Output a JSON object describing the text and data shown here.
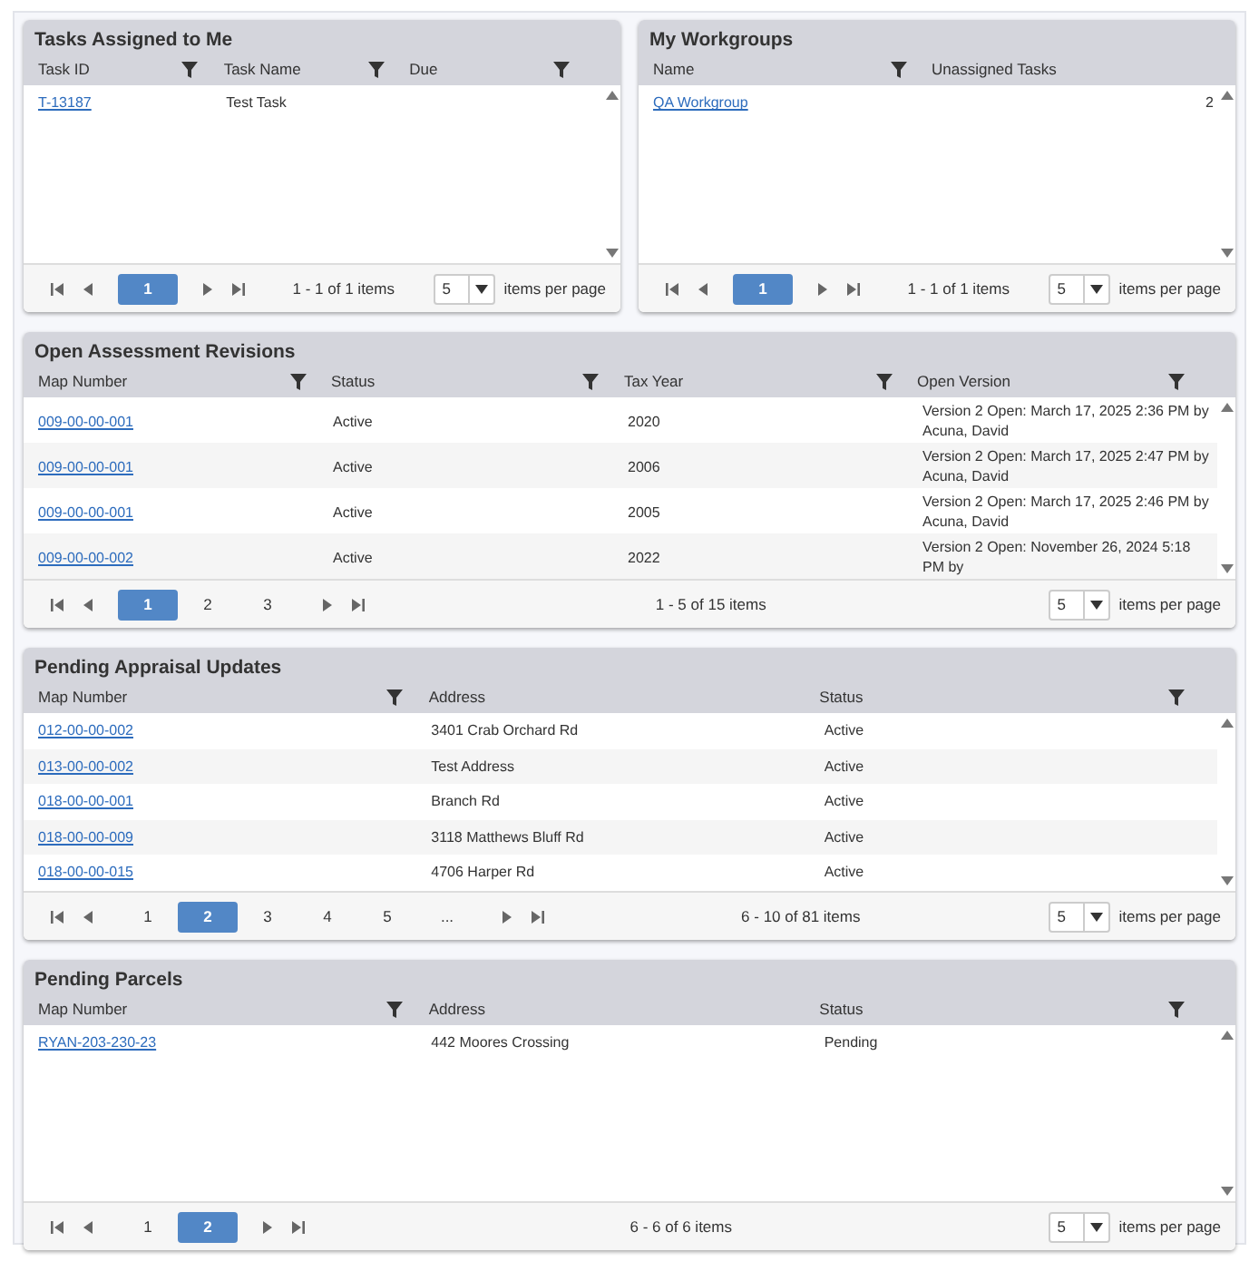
{
  "panels": [
    {
      "title": "Tasks Assigned to Me",
      "columns": [
        {
          "label": "Task ID",
          "kind": "link",
          "filterable": true
        },
        {
          "label": "Task Name",
          "kind": "text",
          "filterable": true
        },
        {
          "label": "Due",
          "kind": "text",
          "filterable": true
        }
      ],
      "rows": [
        [
          "T-13187",
          "Test Task",
          ""
        ]
      ],
      "pager": {
        "pages": [
          {
            "label": "1",
            "selected": true
          }
        ],
        "info": "1 - 1 of 1 items",
        "page_size": "5",
        "page_size_label": "items per page"
      }
    },
    {
      "title": "My Workgroups",
      "columns": [
        {
          "label": "Name",
          "kind": "link",
          "filterable": true
        },
        {
          "label": "Unassigned Tasks",
          "kind": "number",
          "filterable": false
        }
      ],
      "rows": [
        [
          "QA Workgroup",
          "2"
        ]
      ],
      "pager": {
        "pages": [
          {
            "label": "1",
            "selected": true
          }
        ],
        "info": "1 - 1 of 1 items",
        "page_size": "5",
        "page_size_label": "items per page"
      }
    },
    {
      "title": "Open Assessment Revisions",
      "columns": [
        {
          "label": "Map Number",
          "kind": "link",
          "filterable": true
        },
        {
          "label": "Status",
          "kind": "text",
          "filterable": true
        },
        {
          "label": "Tax Year",
          "kind": "text",
          "filterable": true
        },
        {
          "label": "Open Version",
          "kind": "text",
          "filterable": true
        }
      ],
      "rows": [
        [
          "009-00-00-001",
          "Active",
          "2020",
          "Version 2 Open: March 17, 2025 2:36 PM by Acuna, David"
        ],
        [
          "009-00-00-001",
          "Active",
          "2006",
          "Version 2 Open: March 17, 2025 2:47 PM by Acuna, David"
        ],
        [
          "009-00-00-001",
          "Active",
          "2005",
          "Version 2 Open: March 17, 2025 2:46 PM by Acuna, David"
        ],
        [
          "009-00-00-002",
          "Active",
          "2022",
          "Version 2 Open: November 26, 2024 5:18 PM by"
        ]
      ],
      "pager": {
        "pages": [
          {
            "label": "1",
            "selected": true
          },
          {
            "label": "2",
            "selected": false
          },
          {
            "label": "3",
            "selected": false
          }
        ],
        "info": "1 - 5 of 15 items",
        "page_size": "5",
        "page_size_label": "items per page"
      }
    },
    {
      "title": "Pending Appraisal Updates",
      "columns": [
        {
          "label": "Map Number",
          "kind": "link",
          "filterable": true
        },
        {
          "label": "Address",
          "kind": "text",
          "filterable": false
        },
        {
          "label": "Status",
          "kind": "text",
          "filterable": true
        }
      ],
      "rows": [
        [
          "012-00-00-002",
          "3401 Crab Orchard Rd",
          "Active"
        ],
        [
          "013-00-00-002",
          "Test Address",
          "Active"
        ],
        [
          "018-00-00-001",
          "Branch Rd",
          "Active"
        ],
        [
          "018-00-00-009",
          "3118 Matthews Bluff Rd",
          "Active"
        ],
        [
          "018-00-00-015",
          "4706 Harper Rd",
          "Active"
        ]
      ],
      "pager": {
        "pages": [
          {
            "label": "1",
            "selected": false
          },
          {
            "label": "2",
            "selected": true
          },
          {
            "label": "3",
            "selected": false
          },
          {
            "label": "4",
            "selected": false
          },
          {
            "label": "5",
            "selected": false
          },
          {
            "label": "...",
            "selected": false
          }
        ],
        "info": "6 - 10 of 81 items",
        "page_size": "5",
        "page_size_label": "items per page"
      }
    },
    {
      "title": "Pending Parcels",
      "columns": [
        {
          "label": "Map Number",
          "kind": "link",
          "filterable": true
        },
        {
          "label": "Address",
          "kind": "text",
          "filterable": false
        },
        {
          "label": "Status",
          "kind": "text",
          "filterable": true
        }
      ],
      "rows": [
        [
          "RYAN-203-230-23",
          "442 Moores Crossing",
          "Pending"
        ]
      ],
      "pager": {
        "pages": [
          {
            "label": "1",
            "selected": false
          },
          {
            "label": "2",
            "selected": true
          }
        ],
        "info": "6 - 6 of 6 items",
        "page_size": "5",
        "page_size_label": "items per page"
      }
    }
  ]
}
